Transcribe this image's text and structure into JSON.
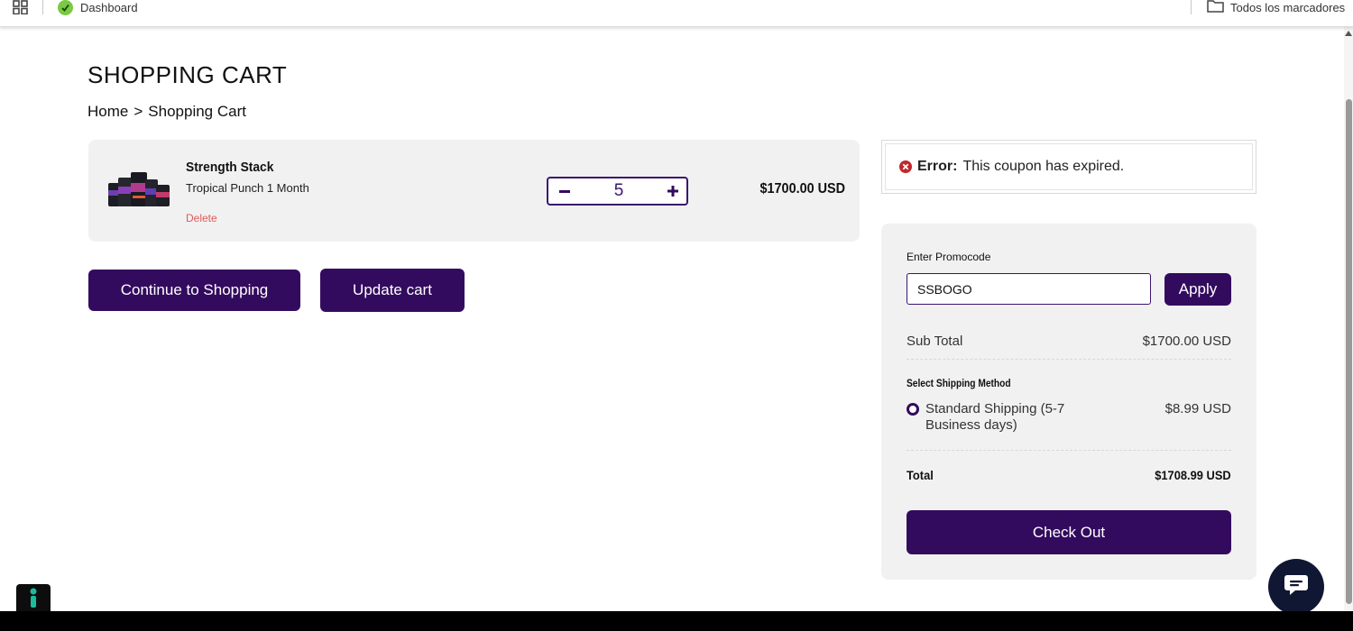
{
  "browser": {
    "bookmark_dashboard": "Dashboard",
    "all_bookmarks": "Todos los marcadores"
  },
  "page": {
    "title": "SHOPPING CART",
    "breadcrumb": [
      "Home",
      ">",
      "Shopping Cart"
    ]
  },
  "cart_item": {
    "name": "Strength Stack",
    "variant": "Tropical Punch 1 Month",
    "delete_label": "Delete",
    "quantity": "5",
    "price": "$1700.00 USD"
  },
  "actions": {
    "continue_label": "Continue to Shopping",
    "update_label": "Update cart"
  },
  "error": {
    "label": "Error:",
    "message": "This coupon has expired."
  },
  "summary": {
    "promo_label": "Enter Promocode",
    "promo_value": "SSBOGO",
    "apply_label": "Apply",
    "subtotal_label": "Sub Total",
    "subtotal_value": "$1700.00 USD",
    "shipping_title": "Select Shipping Method",
    "shipping_option_label": "Standard Shipping (5-7 Business days)",
    "shipping_option_price": "$8.99 USD",
    "total_label": "Total",
    "total_value": "$1708.99 USD",
    "checkout_label": "Check Out"
  },
  "colors": {
    "brand_purple": "#330b5e",
    "error_red": "#c0282d",
    "delete_red": "#e05a5a"
  }
}
